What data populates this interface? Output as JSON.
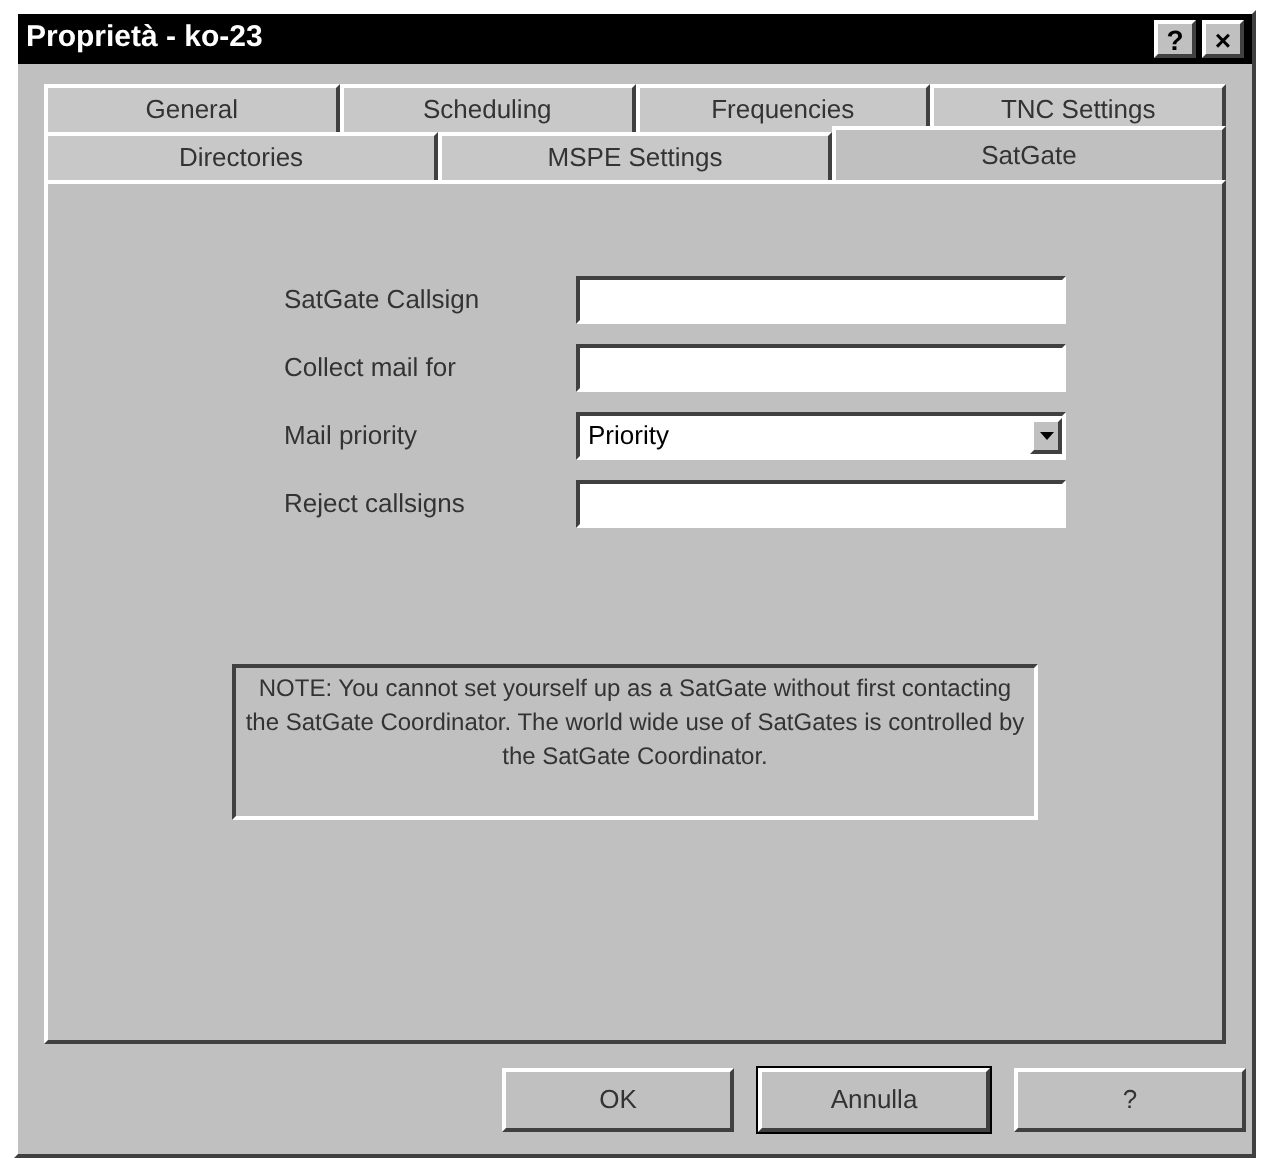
{
  "window": {
    "title": "Proprietà - ko-23",
    "title_buttons": [
      "?",
      "×"
    ]
  },
  "tab_rows": [
    [
      {
        "label": "General",
        "selected": false
      },
      {
        "label": "Scheduling",
        "selected": false
      },
      {
        "label": "Frequencies",
        "selected": false
      },
      {
        "label": "TNC Settings",
        "selected": false
      }
    ],
    [
      {
        "label": "Directories",
        "selected": false
      },
      {
        "label": "MSPE Settings",
        "selected": false
      },
      {
        "label": "SatGate",
        "selected": true
      }
    ]
  ],
  "fields": [
    {
      "label": "SatGate Callsign",
      "kind": "text"
    },
    {
      "label": "Collect mail for",
      "kind": "text"
    },
    {
      "label": "Mail priority",
      "kind": "dropdown",
      "value": "Priority"
    },
    {
      "label": "Reject callsigns",
      "kind": "text"
    }
  ],
  "note": "NOTE:  You cannot set yourself up as a SatGate without first contacting the SatGate Coordinator.  The world wide use of SatGates is controlled by the SatGate Coordinator.",
  "buttons": [
    {
      "label": "OK",
      "default": false
    },
    {
      "label": "Annulla",
      "default": true
    },
    {
      "label": "?",
      "default": false
    }
  ]
}
